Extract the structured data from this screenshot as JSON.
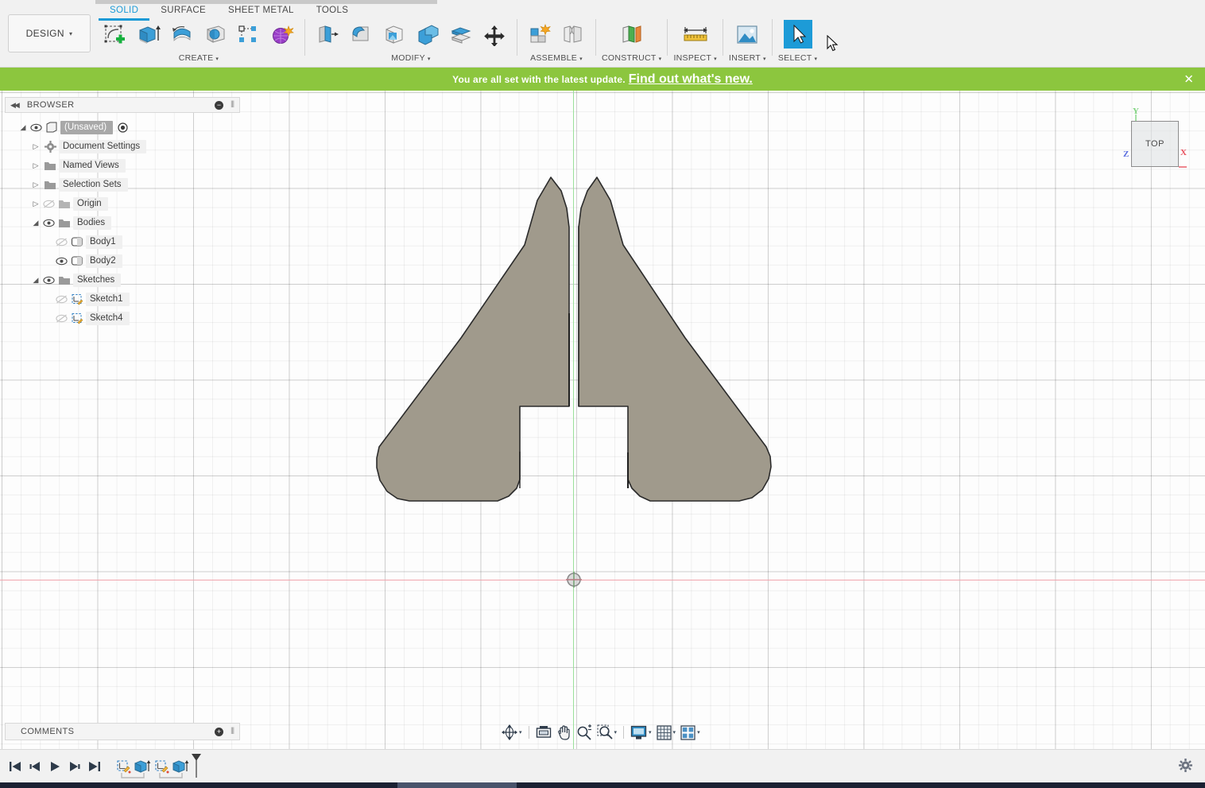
{
  "app": {
    "workspace_label": "DESIGN",
    "workspace_caret": "▾"
  },
  "ribbon": {
    "tabs": [
      {
        "label": "SOLID",
        "active": true
      },
      {
        "label": "SURFACE",
        "active": false
      },
      {
        "label": "SHEET METAL",
        "active": false
      },
      {
        "label": "TOOLS",
        "active": false
      }
    ],
    "groups": [
      {
        "name": "CREATE",
        "caret": "▾",
        "icons": [
          "create-sketch-icon",
          "extrude-icon",
          "revolve-icon",
          "sweep-icon",
          "pattern-icon",
          "form-icon"
        ]
      },
      {
        "name": "MODIFY",
        "caret": "▾",
        "icons": [
          "press-pull-icon",
          "fillet-icon",
          "shell-icon",
          "combine-icon",
          "split-face-icon",
          "move-copy-icon"
        ]
      },
      {
        "name": "ASSEMBLE",
        "caret": "▾",
        "icons": [
          "new-component-icon",
          "joint-icon"
        ]
      },
      {
        "name": "CONSTRUCT",
        "caret": "▾",
        "icons": [
          "construct-plane-icon"
        ]
      },
      {
        "name": "INSPECT",
        "caret": "▾",
        "icons": [
          "measure-icon"
        ]
      },
      {
        "name": "INSERT",
        "caret": "▾",
        "icons": [
          "insert-image-icon"
        ]
      },
      {
        "name": "SELECT",
        "caret": "▾",
        "icons": [
          "select-cursor-icon"
        ]
      }
    ]
  },
  "notification": {
    "message": "You are all set with the latest update.",
    "link_text": "Find out what's new.",
    "close_label": "✕",
    "background_color": "#8cc63e"
  },
  "browser": {
    "title": "BROWSER",
    "collapse_icon": "collapse-left-icon",
    "minimize_label": "−",
    "grip_label": "⦀",
    "tree": [
      {
        "label": "(Unsaved)",
        "indent": 0,
        "arrow": "expanded",
        "eye": "visible",
        "icon": "document-icon",
        "selected": true,
        "radio": true
      },
      {
        "label": "Document Settings",
        "indent": 1,
        "arrow": "collapsed",
        "eye": "none",
        "icon": "gear-icon",
        "selected": false,
        "radio": false
      },
      {
        "label": "Named Views",
        "indent": 1,
        "arrow": "collapsed",
        "eye": "none",
        "icon": "folder-icon",
        "selected": false,
        "radio": false
      },
      {
        "label": "Selection Sets",
        "indent": 1,
        "arrow": "collapsed",
        "eye": "none",
        "icon": "folder-icon",
        "selected": false,
        "radio": false
      },
      {
        "label": "Origin",
        "indent": 1,
        "arrow": "collapsed",
        "eye": "hidden",
        "icon": "folder-icon",
        "selected": false,
        "radio": false
      },
      {
        "label": "Bodies",
        "indent": 1,
        "arrow": "expanded",
        "eye": "visible",
        "icon": "folder-icon",
        "selected": false,
        "radio": false
      },
      {
        "label": "Body1",
        "indent": 2,
        "arrow": "none",
        "eye": "hidden",
        "icon": "body-icon",
        "selected": false,
        "radio": false
      },
      {
        "label": "Body2",
        "indent": 2,
        "arrow": "none",
        "eye": "visible",
        "icon": "body-icon",
        "selected": false,
        "radio": false
      },
      {
        "label": "Sketches",
        "indent": 1,
        "arrow": "expanded",
        "eye": "visible",
        "icon": "folder-icon",
        "selected": false,
        "radio": false
      },
      {
        "label": "Sketch1",
        "indent": 2,
        "arrow": "none",
        "eye": "hidden",
        "icon": "sketch-icon",
        "selected": false,
        "radio": false
      },
      {
        "label": "Sketch4",
        "indent": 2,
        "arrow": "none",
        "eye": "hidden",
        "icon": "sketch-icon",
        "selected": false,
        "radio": false
      }
    ]
  },
  "comments": {
    "title": "COMMENTS",
    "add_label": "+",
    "grip_label": "⦀"
  },
  "viewcube": {
    "face_label": "TOP",
    "axis_x_label": "X",
    "axis_y_label": "Y",
    "axis_z_label": "Z",
    "axis_x_color": "#e8525f",
    "axis_y_color": "#7fd37f",
    "axis_z_color": "#5b6fe0"
  },
  "canvas": {
    "background_color": "#fdfdfd",
    "body_fill_color": "#a09a8c",
    "body_edge_color": "#2b2b2b",
    "axis_x_color": "#f0a5ad",
    "axis_y_color": "#9be09b",
    "origin_marker": "origin-point-icon"
  },
  "navbar": {
    "items": [
      {
        "name": "orbit-icon",
        "caret": "▾"
      },
      {
        "name": "fit-view-icon",
        "caret": ""
      },
      {
        "name": "pan-hand-icon",
        "caret": ""
      },
      {
        "name": "zoom-icon",
        "caret": ""
      },
      {
        "name": "zoom-window-icon",
        "caret": "▾"
      },
      {
        "name": "display-settings-icon",
        "caret": "▾"
      },
      {
        "name": "grid-snaps-icon",
        "caret": "▾"
      },
      {
        "name": "viewports-icon",
        "caret": "▾"
      }
    ]
  },
  "timeline": {
    "playback": [
      "skip-to-start-icon",
      "step-back-icon",
      "play-icon",
      "step-forward-icon",
      "skip-to-end-icon"
    ],
    "features": [
      "sketch-feature-icon",
      "extrude-feature-icon",
      "sketch-feature-icon",
      "extrude-feature-icon"
    ],
    "end_marker": "timeline-end-marker-icon",
    "settings_icon": "gear-icon"
  }
}
